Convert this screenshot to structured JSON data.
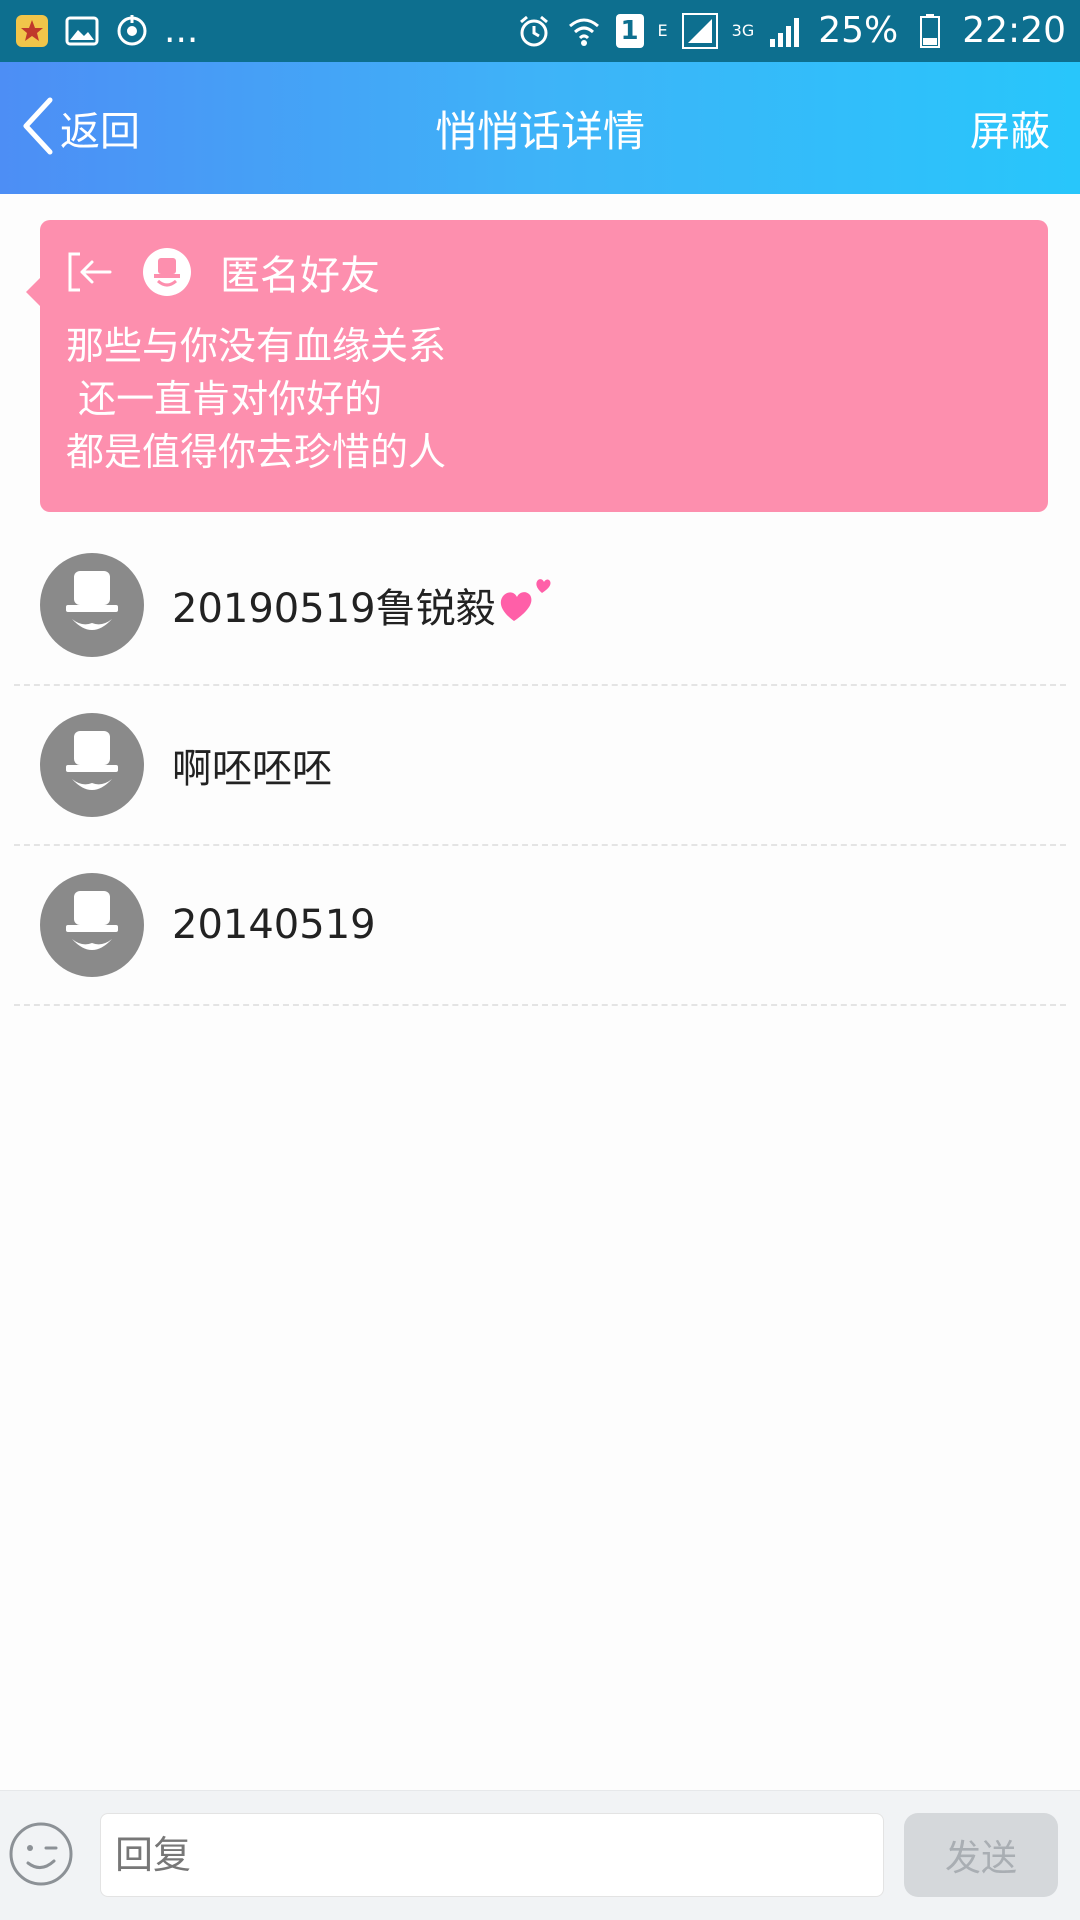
{
  "status_bar": {
    "more": "...",
    "network_e": "E",
    "network_3g": "3G",
    "sim_slot": "1",
    "battery": "25%",
    "time": "22:20"
  },
  "header": {
    "back_label": "返回",
    "title": "悄悄话详情",
    "shield_label": "屏蔽"
  },
  "whisper": {
    "sender": "匿名好友",
    "message": "那些与你没有血缘关系\n 还一直肯对你好的\n都是值得你去珍惜的人"
  },
  "replies": [
    {
      "name": "20190519鲁锐毅",
      "has_heart": true
    },
    {
      "name": "啊呸呸呸",
      "has_heart": false
    },
    {
      "name": "20140519",
      "has_heart": false
    }
  ],
  "composer": {
    "placeholder": "回复",
    "send_label": "发送"
  },
  "colors": {
    "status_bar": "#0d6f8f",
    "header_start": "#4d8ef5",
    "header_end": "#28c6fb",
    "card_bg": "#fd8fae",
    "avatar_gray": "#8a8a8a",
    "send_bg": "#d5d8db"
  }
}
